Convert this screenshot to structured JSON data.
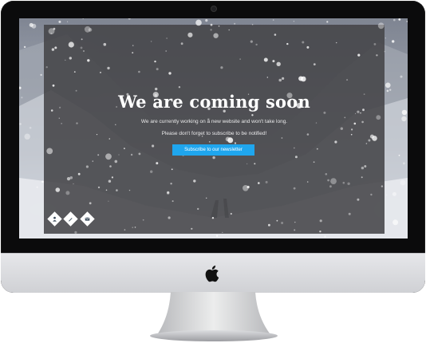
{
  "page": {
    "headline": "We are coming soon",
    "line1": "We are currently working on a new website and won't take long.",
    "line2": "Please don't forget to subscribe to be notified!",
    "cta_label": "Subscribe to our newsletter"
  },
  "social_links": [
    {
      "icon": "person-icon"
    },
    {
      "icon": "pencil-icon"
    },
    {
      "icon": "mail-icon"
    }
  ],
  "colors": {
    "accent": "#1fa6ee",
    "overlay": "#444448",
    "bezel": "#0b0b0c",
    "chin": "#dcdde0"
  }
}
